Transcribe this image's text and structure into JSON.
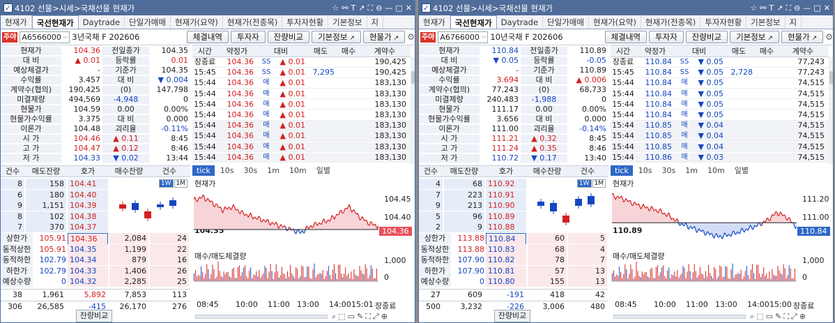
{
  "windows": [
    {
      "title": "4102 선물>시세>국채선물 현재가",
      "tabs": [
        "현재가",
        "국선현재가",
        "Daytrade",
        "단일가매매",
        "현재가(요약)",
        "현재가(전종목)",
        "투자자현황",
        "기본정보",
        "지"
      ],
      "active_tab": 1,
      "code_badge": "주야",
      "code": "A6566000",
      "name": "3년국채 F 202606",
      "buttons": [
        "체결내역",
        "투자자",
        "잔량비교",
        "기본정보",
        "현물가"
      ],
      "info": [
        {
          "l": "현재가",
          "v": "104.36",
          "vc": "red",
          "l2": "전일종가",
          "v2": "104.35",
          "v2c": ""
        },
        {
          "l": "대 비",
          "v": "▲ 0.01",
          "vc": "red",
          "l2": "등락률",
          "v2": "0.01",
          "v2c": "red"
        },
        {
          "l": "예상체결가",
          "v": "-",
          "vc": "",
          "l2": "기준가",
          "v2": "104.35",
          "v2c": ""
        },
        {
          "l": "수익률",
          "v": "3.457",
          "vc": "",
          "l2": "대 비",
          "v2": "▼ 0.004",
          "v2c": "blue"
        },
        {
          "l": "계약수(협의)",
          "v": "190,425",
          "vc": "",
          "l2": "(0)",
          "v2": "147,798",
          "v2c": ""
        },
        {
          "l": "미결제량",
          "v": "494,569",
          "vc": "",
          "l2": "-4,948",
          "v2": "0",
          "v2c": ""
        },
        {
          "l": "현물가",
          "v": "104.59",
          "vc": "",
          "l2": "0.00",
          "v2": "0.00%",
          "v2c": ""
        },
        {
          "l": "현물가수익률",
          "v": "3.375",
          "vc": "",
          "l2": "대 비",
          "v2": "0.000",
          "v2c": ""
        },
        {
          "l": "이론가",
          "v": "104.48",
          "vc": "",
          "l2": "괴리율",
          "v2": "-0.11%",
          "v2c": "blue"
        },
        {
          "l": "시 가",
          "v": "104.46",
          "vc": "red",
          "l2": "▲ 0.11",
          "v2": "8:45",
          "v2c": ""
        },
        {
          "l": "고 가",
          "v": "104.47",
          "vc": "red",
          "l2": "▲ 0.12",
          "v2": "8:46",
          "v2c": ""
        },
        {
          "l": "저 가",
          "v": "104.33",
          "vc": "blue",
          "l2": "▼ 0.02",
          "v2": "13:44",
          "v2c": ""
        }
      ],
      "tick_headers": [
        "시간",
        "약정가",
        "대비",
        "매도",
        "매수",
        "계약수"
      ],
      "ticks": [
        {
          "t": "장종료",
          "p": "104.36",
          "s": "SS",
          "d": "▲ 0.01",
          "a": "",
          "b": "",
          "q": "190,425"
        },
        {
          "t": "15:45",
          "p": "104.36",
          "s": "SS",
          "d": "▲ 0.01",
          "a": "7,295",
          "b": "",
          "q": "190,425"
        },
        {
          "t": "15:44",
          "p": "104.36",
          "s": "매",
          "d": "▲ 0.01",
          "a": "",
          "b": "",
          "q": "183,130"
        },
        {
          "t": "15:44",
          "p": "104.36",
          "s": "매",
          "d": "▲ 0.01",
          "a": "",
          "b": "",
          "q": "183,130"
        },
        {
          "t": "15:44",
          "p": "104.36",
          "s": "매",
          "d": "▲ 0.01",
          "a": "",
          "b": "",
          "q": "183,130"
        },
        {
          "t": "15:44",
          "p": "104.36",
          "s": "매",
          "d": "▲ 0.01",
          "a": "",
          "b": "",
          "q": "183,130"
        },
        {
          "t": "15:44",
          "p": "104.36",
          "s": "매",
          "d": "▲ 0.01",
          "a": "",
          "b": "",
          "q": "183,130"
        },
        {
          "t": "15:44",
          "p": "104.36",
          "s": "매",
          "d": "▲ 0.01",
          "a": "",
          "b": "",
          "q": "183,130"
        },
        {
          "t": "15:44",
          "p": "104.36",
          "s": "매",
          "d": "▲ 0.01",
          "a": "",
          "b": "",
          "q": "183,130"
        },
        {
          "t": "15:44",
          "p": "104.36",
          "s": "매",
          "d": "▲ 0.01",
          "a": "",
          "b": "",
          "q": "183,130"
        }
      ],
      "hoga_headers": [
        "건수",
        "매도잔량",
        "호가",
        "매수잔량",
        "건수"
      ],
      "asks": [
        {
          "c": "8",
          "q": "158",
          "p": "104.41"
        },
        {
          "c": "6",
          "q": "180",
          "p": "104.40"
        },
        {
          "c": "9",
          "q": "1,151",
          "p": "104.39"
        },
        {
          "c": "8",
          "q": "102",
          "p": "104.38"
        },
        {
          "c": "7",
          "q": "370",
          "p": "104.37"
        }
      ],
      "bids": [
        {
          "l": "상한가",
          "lv": "105.91",
          "p": "104.36",
          "q": "2,084",
          "c": "24"
        },
        {
          "l": "동적상한",
          "lv": "105.91",
          "p": "104.35",
          "q": "1,199",
          "c": "22"
        },
        {
          "l": "동적하한",
          "lv": "102.79",
          "p": "104.34",
          "q": "879",
          "c": "16"
        },
        {
          "l": "하한가",
          "lv": "102.79",
          "p": "104.33",
          "q": "1,406",
          "c": "26"
        },
        {
          "l": "예상수량",
          "lv": "0",
          "p": "104.32",
          "q": "2,285",
          "c": "25"
        }
      ],
      "tot1": {
        "c": "38",
        "q": "1,961",
        "d": "5,892",
        "bq": "7,853",
        "bc": "113"
      },
      "tot2": {
        "c": "306",
        "q": "26,585",
        "d": "-415",
        "bq": "26,170",
        "bc": "276"
      },
      "compare_label": "잔량비교",
      "week_tabs": [
        "1W",
        "1M"
      ],
      "chart_tabs": [
        "tick",
        "10s",
        "30s",
        "1m",
        "10m",
        "일별"
      ],
      "chart_title": "현재가",
      "chart_y": [
        "104.45",
        "104.40"
      ],
      "ref_label": "104.35",
      "price_label": "104.36",
      "vol_title": "매수/매도체결량",
      "vol_y": [
        "1,000",
        "0"
      ],
      "x_labels": [
        "08:45",
        "10:00",
        "11:00",
        "13:00",
        "14:00",
        "15:01",
        "장종료"
      ]
    },
    {
      "title": "4102 선물>시세>국채선물 현재가",
      "tabs": [
        "현재가",
        "국선현재가",
        "Daytrade",
        "단일가매매",
        "현재가(요약)",
        "현재가(전종목)",
        "투자자현황",
        "기본정보",
        "지"
      ],
      "active_tab": 1,
      "code_badge": "주야",
      "code": "A6766000",
      "name": "10년국채 F 202606",
      "buttons": [
        "체결내역",
        "투자자",
        "잔량비교",
        "기본정보",
        "현물가"
      ],
      "info": [
        {
          "l": "현재가",
          "v": "110.84",
          "vc": "blue",
          "l2": "전일종가",
          "v2": "110.89",
          "v2c": ""
        },
        {
          "l": "대 비",
          "v": "▼ 0.05",
          "vc": "blue",
          "l2": "등락률",
          "v2": "-0.05",
          "v2c": "blue"
        },
        {
          "l": "예상체결가",
          "v": "-",
          "vc": "",
          "l2": "기준가",
          "v2": "110.89",
          "v2c": ""
        },
        {
          "l": "수익률",
          "v": "3.694",
          "vc": "red",
          "l2": "대 비",
          "v2": "▲ 0.006",
          "v2c": "red"
        },
        {
          "l": "계약수(협의)",
          "v": "77,243",
          "vc": "",
          "l2": "(0)",
          "v2": "68,733",
          "v2c": ""
        },
        {
          "l": "미결제량",
          "v": "240,483",
          "vc": "",
          "l2": "-1,988",
          "v2": "0",
          "v2c": ""
        },
        {
          "l": "현물가",
          "v": "111.17",
          "vc": "",
          "l2": "0.00",
          "v2": "0.00%",
          "v2c": ""
        },
        {
          "l": "현물가수익률",
          "v": "3.656",
          "vc": "",
          "l2": "대 비",
          "v2": "0.000",
          "v2c": ""
        },
        {
          "l": "이론가",
          "v": "111.00",
          "vc": "",
          "l2": "괴리율",
          "v2": "-0.14%",
          "v2c": "blue"
        },
        {
          "l": "시 가",
          "v": "111.21",
          "vc": "red",
          "l2": "▲ 0.32",
          "v2": "8:45",
          "v2c": ""
        },
        {
          "l": "고 가",
          "v": "111.24",
          "vc": "red",
          "l2": "▲ 0.35",
          "v2": "8:46",
          "v2c": ""
        },
        {
          "l": "저 가",
          "v": "110.72",
          "vc": "blue",
          "l2": "▼ 0.17",
          "v2": "13:40",
          "v2c": ""
        }
      ],
      "tick_headers": [
        "시간",
        "약정가",
        "대비",
        "매도",
        "매수",
        "계약수"
      ],
      "ticks": [
        {
          "t": "장종료",
          "p": "110.84",
          "s": "SS",
          "d": "▼ 0.05",
          "a": "",
          "b": "",
          "q": "77,243"
        },
        {
          "t": "15:45",
          "p": "110.84",
          "s": "SS",
          "d": "▼ 0.05",
          "a": "2,728",
          "b": "",
          "q": "77,243"
        },
        {
          "t": "15:44",
          "p": "110.84",
          "s": "매",
          "d": "▼ 0.05",
          "a": "",
          "b": "",
          "q": "74,515"
        },
        {
          "t": "15:44",
          "p": "110.84",
          "s": "매",
          "d": "▼ 0.05",
          "a": "",
          "b": "",
          "q": "74,515"
        },
        {
          "t": "15:44",
          "p": "110.84",
          "s": "매",
          "d": "▼ 0.05",
          "a": "",
          "b": "",
          "q": "74,515"
        },
        {
          "t": "15:44",
          "p": "110.84",
          "s": "매",
          "d": "▼ 0.05",
          "a": "",
          "b": "",
          "q": "74,515"
        },
        {
          "t": "15:44",
          "p": "110.85",
          "s": "매",
          "d": "▼ 0.04",
          "a": "",
          "b": "",
          "q": "74,515"
        },
        {
          "t": "15:44",
          "p": "110.85",
          "s": "매",
          "d": "▼ 0.04",
          "a": "",
          "b": "",
          "q": "74,515"
        },
        {
          "t": "15:44",
          "p": "110.85",
          "s": "매",
          "d": "▼ 0.04",
          "a": "",
          "b": "",
          "q": "74,515"
        },
        {
          "t": "15:44",
          "p": "110.86",
          "s": "매",
          "d": "▼ 0.03",
          "a": "",
          "b": "",
          "q": "74,515"
        }
      ],
      "hoga_headers": [
        "건수",
        "매도잔량",
        "호가",
        "매수잔량",
        "건수"
      ],
      "asks": [
        {
          "c": "4",
          "q": "68",
          "p": "110.92"
        },
        {
          "c": "7",
          "q": "223",
          "p": "110.91"
        },
        {
          "c": "9",
          "q": "213",
          "p": "110.90"
        },
        {
          "c": "5",
          "q": "96",
          "p": "110.89"
        },
        {
          "c": "2",
          "q": "9",
          "p": "110.88"
        }
      ],
      "bids": [
        {
          "l": "상한가",
          "lv": "113.88",
          "p": "110.84",
          "q": "60",
          "c": "5"
        },
        {
          "l": "동적상한",
          "lv": "113.88",
          "p": "110.83",
          "q": "68",
          "c": "4"
        },
        {
          "l": "동적하한",
          "lv": "107.90",
          "p": "110.82",
          "q": "78",
          "c": "7"
        },
        {
          "l": "하한가",
          "lv": "107.90",
          "p": "110.81",
          "q": "57",
          "c": "13"
        },
        {
          "l": "예상수량",
          "lv": "0",
          "p": "110.80",
          "q": "155",
          "c": "13"
        }
      ],
      "tot1": {
        "c": "27",
        "q": "609",
        "d": "-191",
        "bq": "418",
        "bc": "42"
      },
      "tot2": {
        "c": "500",
        "q": "3,232",
        "d": "-226",
        "bq": "3,006",
        "bc": "480"
      },
      "compare_label": "잔량비교",
      "week_tabs": [
        "1W",
        "1M"
      ],
      "chart_tabs": [
        "tick",
        "10s",
        "30s",
        "1m",
        "10m",
        "일별"
      ],
      "chart_title": "현재가",
      "chart_y": [
        "111.20",
        "111.00"
      ],
      "ref_label": "110.89",
      "price_label": "110.84",
      "vol_title": "매수/매도체결량",
      "vol_y": [
        "1,000",
        "0"
      ],
      "x_labels": [
        "08:45",
        "10:00",
        "11:00",
        "13:00",
        "14:00",
        "15:00",
        "장종료"
      ]
    }
  ],
  "colors": {
    "up": "#d32020",
    "down": "#1546c2",
    "title_bar": "#506c99",
    "ask_bg": "#e6edf8",
    "bid_bg": "#fbe8ea"
  },
  "chart_data": [
    {
      "type": "line",
      "title": "현재가",
      "x": [
        "08:45",
        "10:00",
        "11:00",
        "13:00",
        "14:00",
        "15:01",
        "장종료"
      ],
      "series": [
        {
          "values": [
            104.44,
            104.45,
            104.43,
            104.41,
            104.42,
            104.4,
            104.39,
            104.38,
            104.37,
            104.36,
            104.35,
            104.34,
            104.36,
            104.37,
            104.38,
            104.4,
            104.42,
            104.39,
            104.37,
            104.36
          ]
        }
      ],
      "reference": 104.35,
      "ylim": [
        104.32,
        104.47
      ]
    },
    {
      "type": "line",
      "title": "현재가",
      "x": [
        "08:45",
        "10:00",
        "11:00",
        "13:00",
        "14:00",
        "15:00",
        "장종료"
      ],
      "series": [
        {
          "values": [
            111.2,
            111.17,
            111.12,
            111.08,
            111.05,
            111.02,
            110.96,
            110.88,
            110.84,
            110.8,
            110.76,
            110.73,
            110.75,
            110.78,
            110.82,
            110.86,
            110.92,
            111.01,
            110.95,
            110.84
          ]
        }
      ],
      "reference": 110.89,
      "ylim": [
        110.7,
        111.26
      ]
    }
  ]
}
